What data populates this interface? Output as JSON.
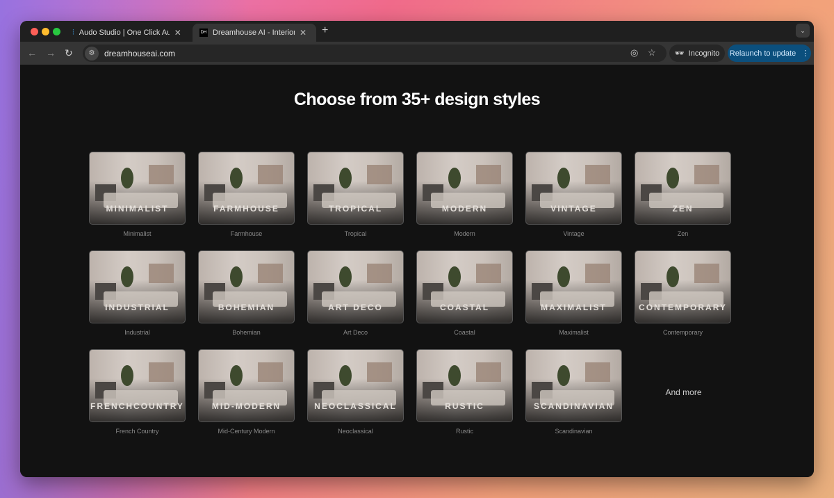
{
  "browser": {
    "tabs": [
      {
        "title": "Audo Studio | One Click Audio",
        "icon": "audio-wave-icon",
        "active": false
      },
      {
        "title": "Dreamhouse AI - Interior Design",
        "icon": "dreamhouse-logo-icon",
        "active": true
      }
    ],
    "url": "dreamhouseai.com",
    "incognito_label": "Incognito",
    "relaunch_label": "Relaunch to update",
    "accent": "#0b4f7d"
  },
  "page": {
    "heading": "Choose from 35+ design styles",
    "styles": [
      {
        "overlay": "MINIMALIST",
        "caption": "Minimalist"
      },
      {
        "overlay": "FARMHOUSE",
        "caption": "Farmhouse"
      },
      {
        "overlay": "TROPICAL",
        "caption": "Tropical"
      },
      {
        "overlay": "MODERN",
        "caption": "Modern"
      },
      {
        "overlay": "VINTAGE",
        "caption": "Vintage"
      },
      {
        "overlay": "ZEN",
        "caption": "Zen"
      },
      {
        "overlay": "INDUSTRIAL",
        "caption": "Industrial"
      },
      {
        "overlay": "BOHEMIAN",
        "caption": "Bohemian"
      },
      {
        "overlay": "ART DECO",
        "caption": "Art Deco"
      },
      {
        "overlay": "COASTAL",
        "caption": "Coastal"
      },
      {
        "overlay": "MAXIMALIST",
        "caption": "Maximalist"
      },
      {
        "overlay": "CONTEMPORARY",
        "caption": "Contemporary"
      },
      {
        "overlay": "FRENCHCOUNTRY",
        "caption": "French Country"
      },
      {
        "overlay": "MID-MODERN",
        "caption": "Mid-Century Modern"
      },
      {
        "overlay": "NEOCLASSICAL",
        "caption": "Neoclassical"
      },
      {
        "overlay": "RUSTIC",
        "caption": "Rustic"
      },
      {
        "overlay": "SCANDINAVIAN",
        "caption": "Scandinavian"
      }
    ],
    "more_label": "And more"
  }
}
